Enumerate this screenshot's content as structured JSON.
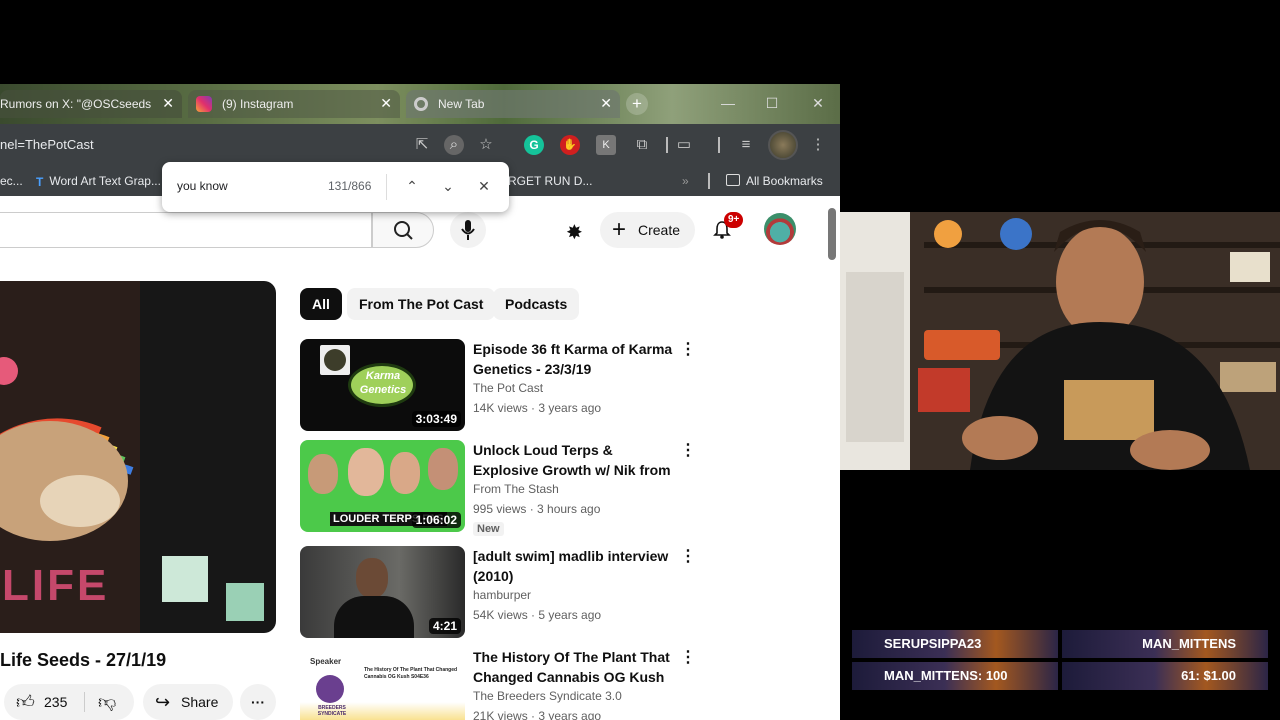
{
  "browser": {
    "tabs": [
      {
        "title": "Rumors on X: \"@OSCseeds",
        "active": false
      },
      {
        "title": "(9) Instagram",
        "active": false
      },
      {
        "title": "New Tab",
        "active": true
      }
    ],
    "url": "nel=ThePotCast",
    "bookmarks": [
      {
        "label": "ec..."
      },
      {
        "label": "Word Art Text Grap..."
      },
      {
        "label": "RGET RUN D..."
      },
      {
        "label": "All Bookmarks"
      }
    ],
    "overflow_chevron": "»"
  },
  "find_bar": {
    "query": "you know",
    "count": "131/866"
  },
  "youtube": {
    "create_label": "Create",
    "notif_badge": "9+",
    "chips": [
      {
        "label": "All",
        "selected": true
      },
      {
        "label": "From The Pot Cast",
        "selected": false
      },
      {
        "label": "Podcasts",
        "selected": false
      }
    ],
    "video_title": "Life Seeds - 27/1/19",
    "likes": "235",
    "share_label": "Share",
    "recommendations": [
      {
        "title": "Episode 36 ft Karma of Karma Genetics - 23/3/19",
        "channel": "The Pot Cast",
        "meta": "14K views · 3 years ago",
        "duration": "3:03:49",
        "badge": ""
      },
      {
        "title": "Unlock Loud Terps & Explosive Growth w/ Nik from Rooted Le...",
        "channel": "From The Stash",
        "meta": "995 views · 3 hours ago",
        "duration": "1:06:02",
        "badge": "New"
      },
      {
        "title": "[adult swim] madlib interview (2010)",
        "channel": "hamburper",
        "meta": "54K views · 5 years ago",
        "duration": "4:21",
        "badge": ""
      },
      {
        "title": "The History Of The Plant That Changed Cannabis OG Kush ...",
        "channel": "The Breeders Syndicate 3.0",
        "meta": "21K views · 3 years ago",
        "duration": "",
        "badge": ""
      }
    ],
    "thumb_texts": {
      "karma": "Karma Genetics",
      "terps": "LOUDER TERPS FAS",
      "speaker": "Speaker",
      "history": "The History Of The Plant That Changed Cannabis OG Kush S04E36",
      "breeders": "BREEDERS SYNDICATE",
      "main_overlay": "LIFE"
    }
  },
  "stream_alerts": {
    "cells": [
      {
        "text": "SERUPSIPPA23"
      },
      {
        "text": "MAN_MITTENS"
      },
      {
        "text": "MAN_MITTENS: 100"
      },
      {
        "text": "61: $1.00"
      }
    ]
  },
  "colors": {
    "yt_red": "#cc0000",
    "chip_dark": "#0f0f0f",
    "browser_chrome": "#3c4043"
  }
}
